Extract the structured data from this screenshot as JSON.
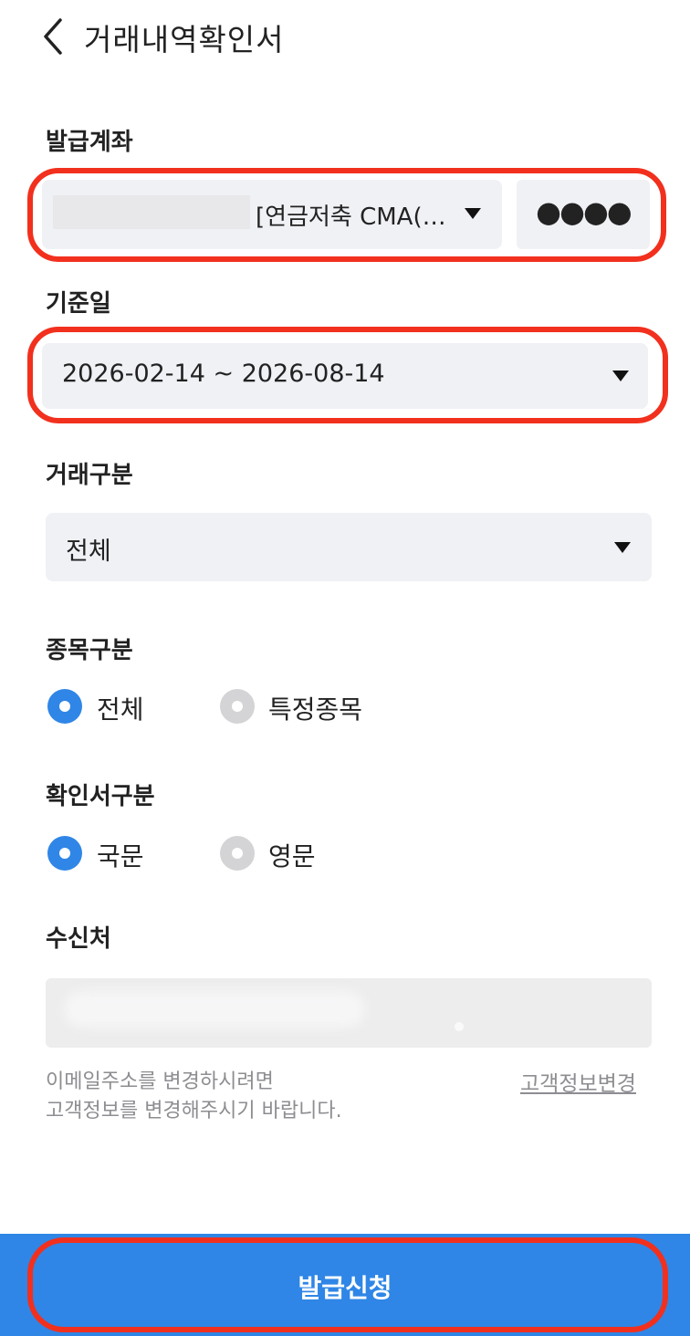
{
  "header": {
    "title": "거래내역확인서",
    "back_icon": "chevron-left-icon"
  },
  "account": {
    "label": "발급계좌",
    "selected": "[연금저축 CMA(…",
    "password": "●●●●"
  },
  "date": {
    "label": "기준일",
    "value": "2026-02-14 ~ 2026-08-14"
  },
  "trade_type": {
    "label": "거래구분",
    "value": "전체"
  },
  "item_type": {
    "label": "종목구분",
    "options": [
      {
        "label": "전체",
        "selected": true
      },
      {
        "label": "특정종목",
        "selected": false
      }
    ]
  },
  "cert_type": {
    "label": "확인서구분",
    "options": [
      {
        "label": "국문",
        "selected": true
      },
      {
        "label": "영문",
        "selected": false
      }
    ]
  },
  "recipient": {
    "label": "수신처",
    "hint_line1": "이메일주소를 변경하시려면",
    "hint_line2": "고객정보를 변경해주시기 바랍니다.",
    "change_link": "고객정보변경"
  },
  "submit": {
    "label": "발급신청"
  },
  "colors": {
    "accent": "#2f86e6",
    "highlight": "#f2301e",
    "field_bg": "#f0f1f5"
  }
}
